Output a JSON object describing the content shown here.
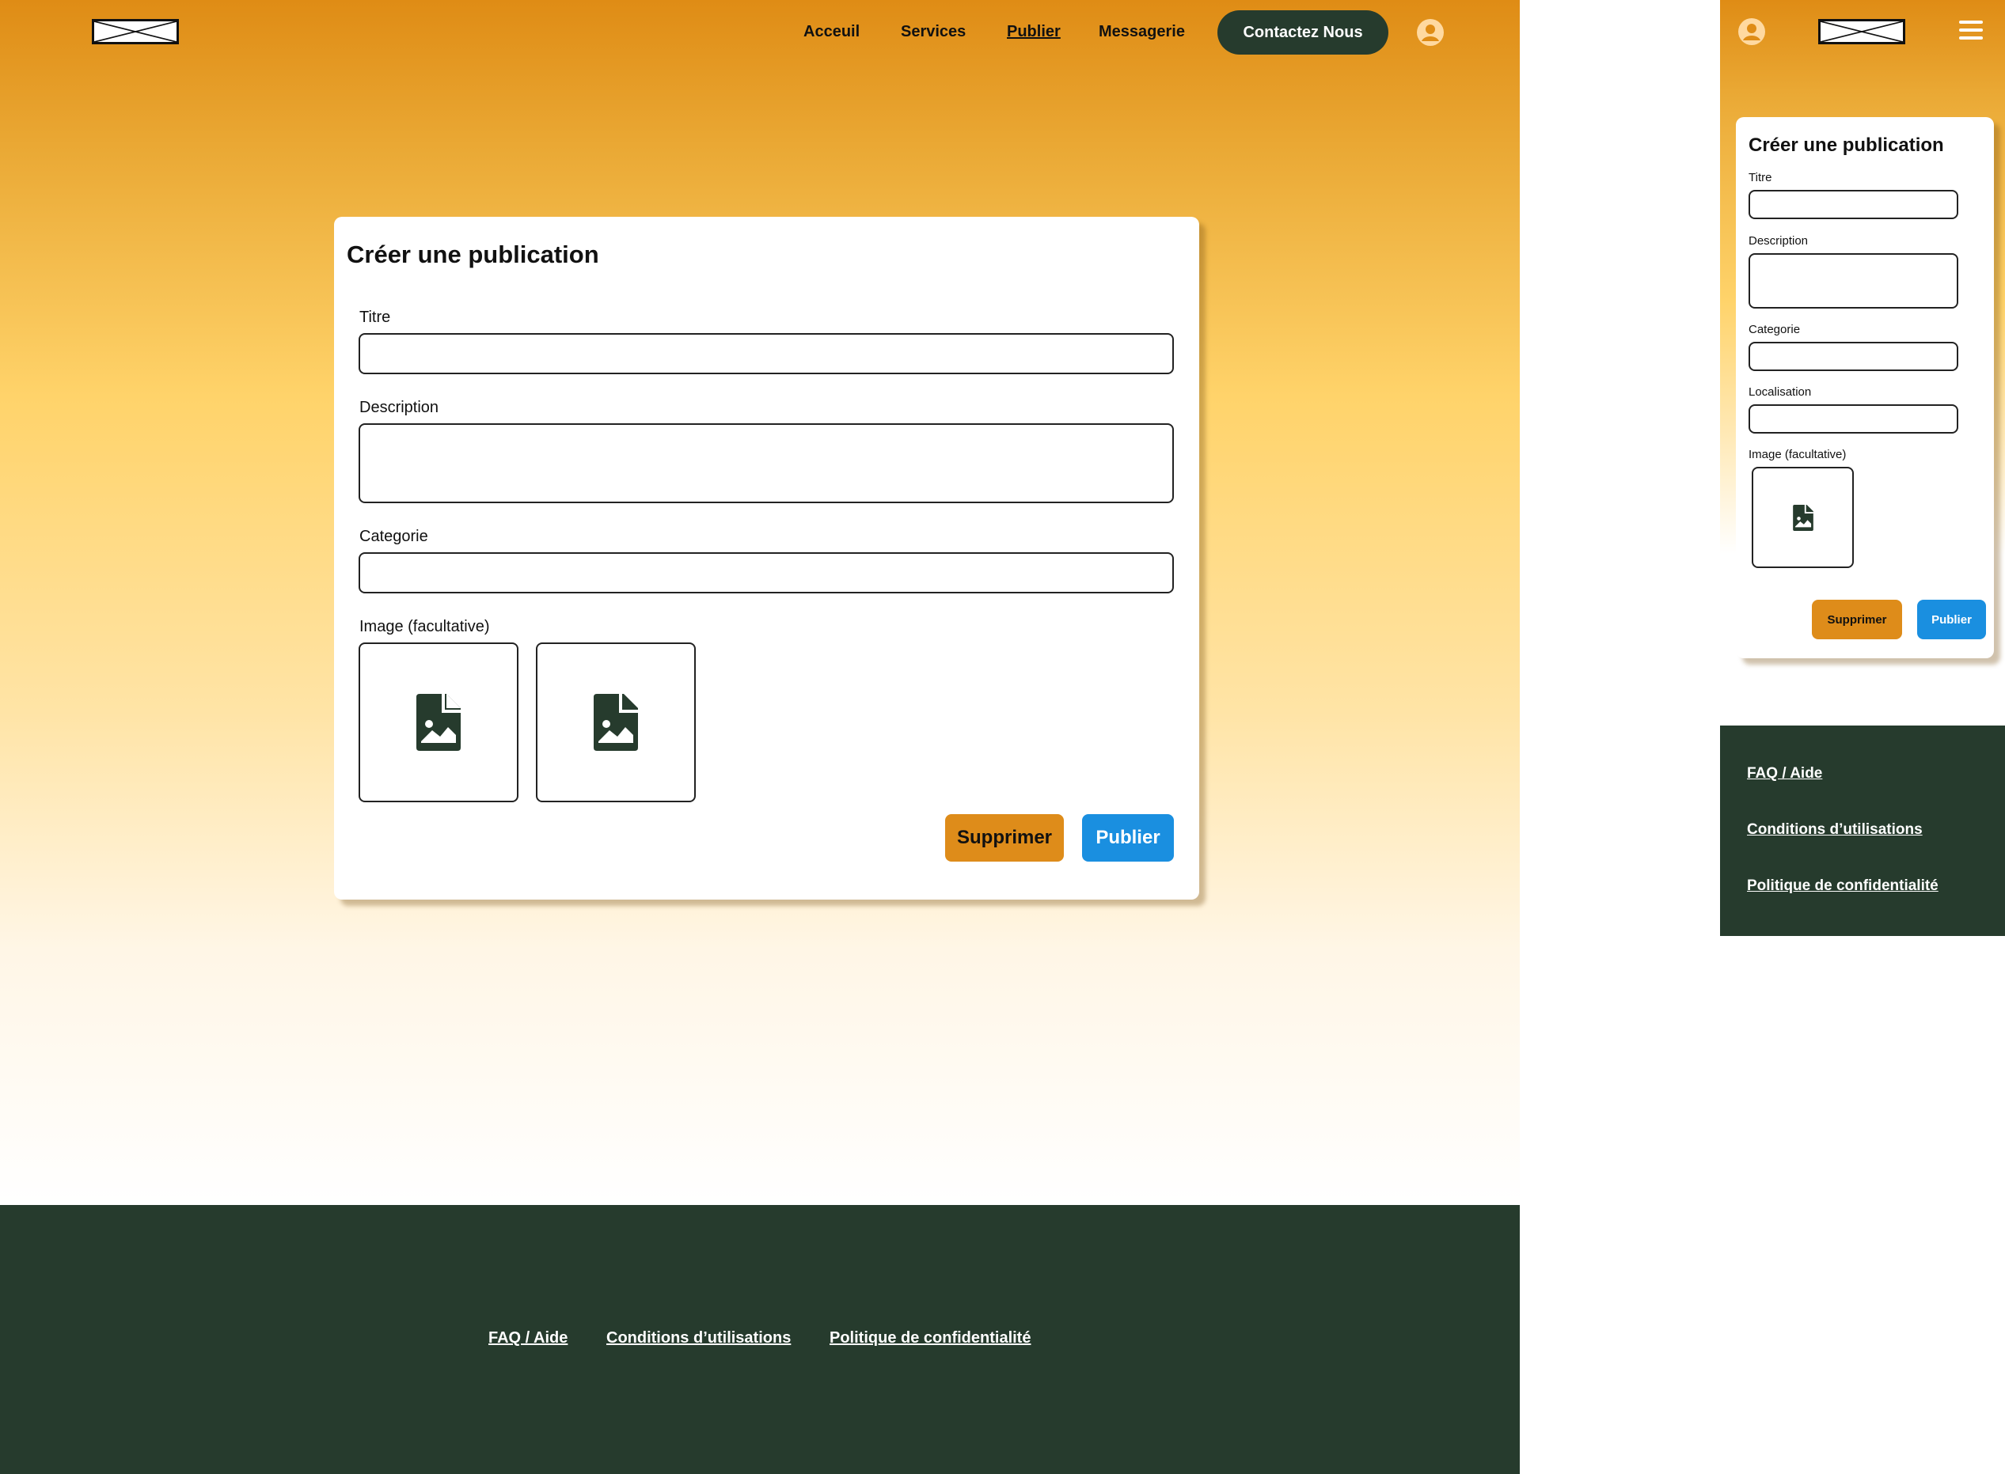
{
  "colors": {
    "brand_orange": "#df8c15",
    "dark_green": "#263b2d",
    "publish_blue": "#1a8fe0",
    "delete_orange": "#de8c1a",
    "user_icon": "#ffd9a0"
  },
  "icons": {
    "logo": "logo-placeholder-icon",
    "user": "user-account-icon",
    "menu": "hamburger-menu-icon",
    "image": "image-file-icon"
  },
  "desktop": {
    "nav": {
      "items": [
        {
          "label": "Acceuil",
          "active": false
        },
        {
          "label": "Services",
          "active": false
        },
        {
          "label": "Publier",
          "active": true
        },
        {
          "label": "Messagerie",
          "active": false
        }
      ],
      "contact": "Contactez Nous"
    },
    "form": {
      "title": "Créer une publication",
      "titre_label": "Titre",
      "description_label": "Description",
      "categorie_label": "Categorie",
      "image_label": "Image (facultative)",
      "delete": "Supprimer",
      "publish": "Publier"
    },
    "footer": {
      "faq": "FAQ / Aide",
      "terms": "Conditions d’utilisations",
      "privacy": "Politique de confidentialité"
    }
  },
  "mobile": {
    "form": {
      "title": "Créer une publication",
      "titre_label": "Titre",
      "description_label": "Description",
      "categorie_label": "Categorie",
      "localisation_label": "Localisation",
      "image_label": "Image (facultative)",
      "delete": "Supprimer",
      "publish": "Publier"
    },
    "footer": {
      "faq": "FAQ / Aide",
      "terms": "Conditions d’utilisations",
      "privacy": "Politique de confidentialité"
    }
  }
}
